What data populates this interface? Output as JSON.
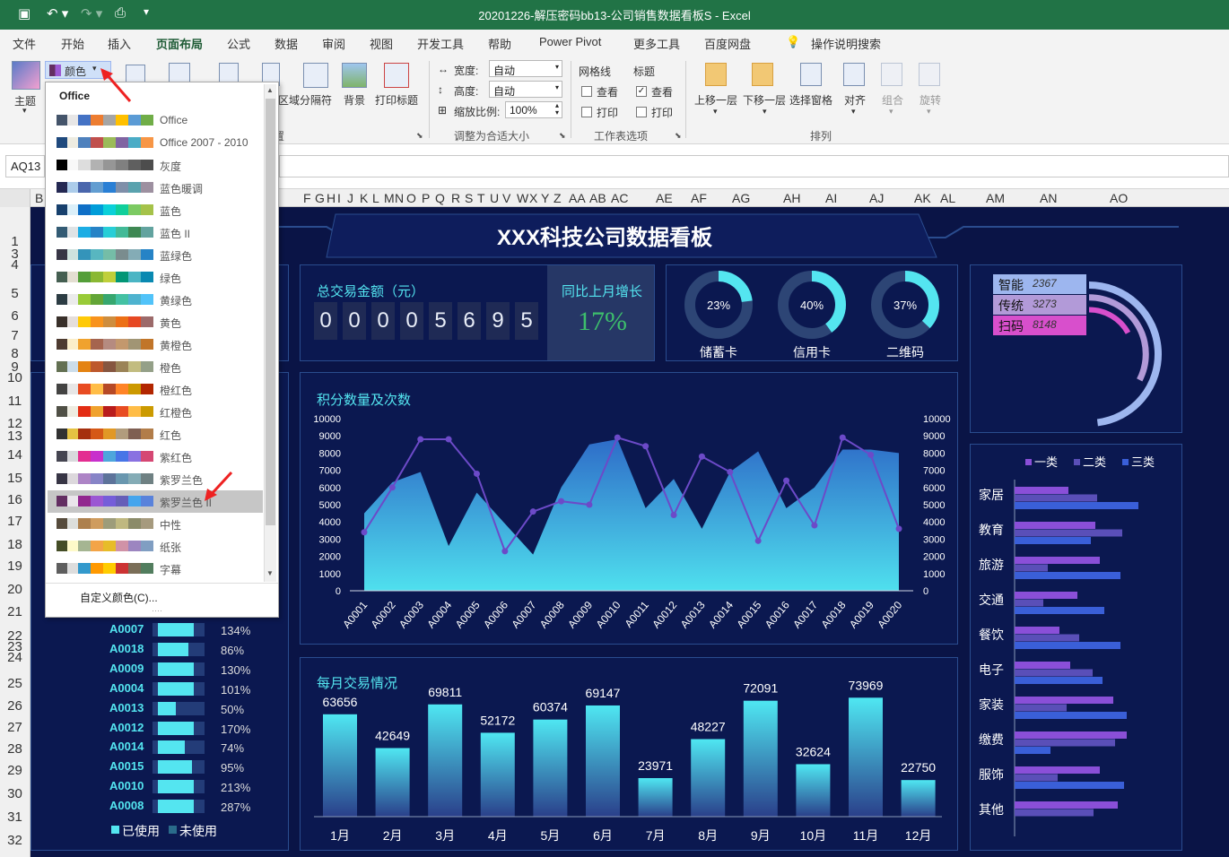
{
  "app": {
    "window_title": "20201226-解压密码bb13-公司销售数据看板S  -  Excel"
  },
  "tabs": [
    "文件",
    "开始",
    "插入",
    "页面布局",
    "公式",
    "数据",
    "审阅",
    "视图",
    "开发工具",
    "帮助",
    "Power Pivot",
    "更多工具",
    "百度网盘"
  ],
  "tab_search": "操作说明搜索",
  "ribbon": {
    "theme_label": "主题",
    "colors_label": "颜色",
    "btn_area": "区域",
    "btn_breaks": "分隔符",
    "btn_background": "背景",
    "btn_print_titles": "打印标题",
    "width_label": "宽度:",
    "width_value": "自动",
    "height_label": "高度:",
    "height_value": "自动",
    "scale_label": "缩放比例:",
    "scale_value": "100%",
    "group_fit": "调整为合适大小",
    "gridlines_label": "网格线",
    "headings_label": "标题",
    "view_label": "查看",
    "print_label": "打印",
    "group_sheet": "工作表选项",
    "bring_forward": "上移一层",
    "send_backward": "下移一层",
    "selection_pane": "选择窗格",
    "align": "对齐",
    "group": "组合",
    "rotate": "旋转",
    "group_arrange": "排列",
    "page_setup_group_suffix": "置"
  },
  "formula_bar": {
    "name_box": "AQ13"
  },
  "columns": [
    "B",
    "F",
    "G",
    "H",
    "I",
    "J",
    "K",
    "L",
    "M",
    "N",
    "O",
    "P",
    "Q",
    "R",
    "S",
    "T",
    "U",
    "V",
    "W",
    "X",
    "Y",
    "Z",
    "AA",
    "AB",
    "AC",
    "AE",
    "AF",
    "AG",
    "AH",
    "AI",
    "AJ",
    "AK",
    "AL",
    "AM",
    "AN",
    "AO"
  ],
  "rows": [
    "1",
    "3",
    "4",
    "5",
    "6",
    "7",
    "8",
    "9",
    "10",
    "11",
    "12",
    "13",
    "14",
    "15",
    "16",
    "17",
    "18",
    "19",
    "20",
    "21",
    "22",
    "23",
    "24",
    "25",
    "26",
    "27",
    "28",
    "29",
    "30",
    "31",
    "32"
  ],
  "dropdown": {
    "header": "Office",
    "items": [
      {
        "name": "Office",
        "colors": [
          "#44546a",
          "#e7e6e6",
          "#4472c4",
          "#ed7d31",
          "#a5a5a5",
          "#ffc000",
          "#5b9bd5",
          "#70ad47"
        ]
      },
      {
        "name": "Office 2007 - 2010",
        "colors": [
          "#1f497d",
          "#eeece1",
          "#4f81bd",
          "#c0504d",
          "#9bbb59",
          "#8064a2",
          "#4bacc6",
          "#f79646"
        ]
      },
      {
        "name": "灰度",
        "colors": [
          "#000000",
          "#f8f8f8",
          "#dddddd",
          "#b2b2b2",
          "#969696",
          "#808080",
          "#5f5f5f",
          "#4d4d4d"
        ]
      },
      {
        "name": "蓝色暖调",
        "colors": [
          "#242852",
          "#acccea",
          "#4a66ac",
          "#629dd1",
          "#297fd5",
          "#7f8fa9",
          "#5aa2ae",
          "#9d90a0"
        ]
      },
      {
        "name": "蓝色",
        "colors": [
          "#17406d",
          "#dbeff9",
          "#0f6fc6",
          "#009dd9",
          "#0bd0d9",
          "#10cf9b",
          "#7cca62",
          "#a5c249"
        ]
      },
      {
        "name": "蓝色 II",
        "colors": [
          "#335b74",
          "#dfe3e5",
          "#1cade4",
          "#2683c6",
          "#27ced7",
          "#42ba97",
          "#3e8853",
          "#62a39f"
        ]
      },
      {
        "name": "蓝绿色",
        "colors": [
          "#373545",
          "#cee2de",
          "#3494ba",
          "#58b6c0",
          "#75bda7",
          "#7a8c8e",
          "#84acb6",
          "#2683c6"
        ]
      },
      {
        "name": "绿色",
        "colors": [
          "#455f51",
          "#e3ded1",
          "#549e39",
          "#8ab833",
          "#c0cf3a",
          "#029676",
          "#4ab5c4",
          "#0989b1"
        ]
      },
      {
        "name": "黄绿色",
        "colors": [
          "#2c3c43",
          "#ebebeb",
          "#99cb38",
          "#63a537",
          "#37a76f",
          "#44c1a3",
          "#4eb3cf",
          "#51c3f9"
        ]
      },
      {
        "name": "黄色",
        "colors": [
          "#39302a",
          "#e5dedb",
          "#ffca08",
          "#f8931d",
          "#ce8d3e",
          "#ec7016",
          "#e64823",
          "#9c6a6a"
        ]
      },
      {
        "name": "黄橙色",
        "colors": [
          "#4e3b30",
          "#fbeec9",
          "#f0a22e",
          "#a5644e",
          "#b58b80",
          "#c3986d",
          "#a19574",
          "#c17529"
        ]
      },
      {
        "name": "橙色",
        "colors": [
          "#637052",
          "#ccddea",
          "#e48312",
          "#bd582c",
          "#865640",
          "#9b8357",
          "#c2bc80",
          "#94a088"
        ]
      },
      {
        "name": "橙红色",
        "colors": [
          "#434342",
          "#e7e6e6",
          "#e84c22",
          "#ffbd47",
          "#b64926",
          "#ff8427",
          "#cc9900",
          "#b22600"
        ]
      },
      {
        "name": "红橙色",
        "colors": [
          "#505046",
          "#eeece1",
          "#e32d14",
          "#f0a22e",
          "#b81c1c",
          "#e84c22",
          "#ffbd47",
          "#cb9a00"
        ]
      },
      {
        "name": "红色",
        "colors": [
          "#323232",
          "#e5c243",
          "#a5300f",
          "#d55816",
          "#e19825",
          "#b19c7d",
          "#7f5f52",
          "#b27d49"
        ]
      },
      {
        "name": "紫红色",
        "colors": [
          "#454551",
          "#d8d9dc",
          "#e32d91",
          "#c830cc",
          "#4ea6dc",
          "#4775e7",
          "#8971e1",
          "#d54773"
        ]
      },
      {
        "name": "紫罗兰色",
        "colors": [
          "#373545",
          "#dcd8dc",
          "#ad84c6",
          "#8784c7",
          "#5d739a",
          "#6997af",
          "#84acb6",
          "#6f8183"
        ]
      },
      {
        "name": "紫罗兰色 II",
        "colors": [
          "#632e62",
          "#eae5eb",
          "#92278f",
          "#9b57d3",
          "#755dd9",
          "#665eb8",
          "#45a5ed",
          "#5982db"
        ]
      },
      {
        "name": "中性",
        "colors": [
          "#564b3c",
          "#dcdedb",
          "#ad804e",
          "#cf9c5e",
          "#9d9c7a",
          "#bfb880",
          "#8b8b69",
          "#a69a7e"
        ]
      },
      {
        "name": "纸张",
        "colors": [
          "#444d26",
          "#fefac9",
          "#a5b592",
          "#f3a447",
          "#e7bc29",
          "#d092a7",
          "#9c85c0",
          "#809ec2"
        ]
      },
      {
        "name": "字幕",
        "colors": [
          "#5e5e5e",
          "#dddddd",
          "#3399cc",
          "#ff9900",
          "#ffcc00",
          "#cc3333",
          "#7a6e58",
          "#527d5e"
        ]
      }
    ],
    "footer": "自定义颜色(C)...",
    "selected_index": 17
  },
  "dashboard": {
    "title": "XXX科技公司数据看板",
    "total_label": "总交易金额（元）",
    "digits": [
      "0",
      "0",
      "0",
      "0",
      "5",
      "6",
      "9",
      "5"
    ],
    "growth_label": "同比上月增长",
    "growth_value": "17%",
    "rings": [
      {
        "label": "储蓄卡",
        "pct": "23%",
        "value": 0.23
      },
      {
        "label": "信用卡",
        "pct": "40%",
        "value": 0.4
      },
      {
        "label": "二维码",
        "pct": "37%",
        "value": 0.37
      }
    ],
    "legend_box": [
      {
        "name": "智能",
        "value": "2367",
        "color": "#9db6ef"
      },
      {
        "name": "传统",
        "value": "3273",
        "color": "#b29ad8"
      },
      {
        "name": "扫码",
        "value": "8148",
        "color": "#d84fcc"
      }
    ],
    "points_title": "积分数量及次数",
    "monthly_title": "每月交易情况",
    "hbar_legend": [
      "一类",
      "二类",
      "三类"
    ],
    "hbar_categories": [
      "家居",
      "教育",
      "旅游",
      "交通",
      "餐饮",
      "电子",
      "家装",
      "缴费",
      "服饰",
      "其他"
    ],
    "progress_legend": [
      "已使用",
      "未使用"
    ],
    "progress_rows": [
      {
        "id": "A0007",
        "pct": "134%",
        "value": 1.34
      },
      {
        "id": "A0018",
        "pct": "86%",
        "value": 0.86
      },
      {
        "id": "A0009",
        "pct": "130%",
        "value": 1.3
      },
      {
        "id": "A0004",
        "pct": "101%",
        "value": 1.01
      },
      {
        "id": "A0013",
        "pct": "50%",
        "value": 0.5
      },
      {
        "id": "A0012",
        "pct": "170%",
        "value": 1.7
      },
      {
        "id": "A0014",
        "pct": "74%",
        "value": 0.74
      },
      {
        "id": "A0015",
        "pct": "95%",
        "value": 0.95
      },
      {
        "id": "A0010",
        "pct": "213%",
        "value": 2.13
      },
      {
        "id": "A0008",
        "pct": "287%",
        "value": 2.87
      }
    ]
  },
  "chart_data": [
    {
      "type": "line",
      "title": "积分数量及次数",
      "x": [
        "A0001",
        "A0002",
        "A0003",
        "A0004",
        "A0005",
        "A0006",
        "A0007",
        "A0008",
        "A0009",
        "A0010",
        "A0011",
        "A0012",
        "A0013",
        "A0014",
        "A0015",
        "A0016",
        "A0017",
        "A0018",
        "A0019",
        "A0020"
      ],
      "ylim": [
        0,
        10000
      ],
      "yticks": [
        "10000",
        "9000",
        "8000",
        "7000",
        "6000",
        "5000",
        "4000",
        "3000",
        "2000",
        "1000",
        "0"
      ],
      "series": [
        {
          "kind": "area",
          "values": [
            4500,
            6300,
            6900,
            2600,
            5700,
            3900,
            2100,
            6000,
            8500,
            8800,
            4800,
            6500,
            3600,
            6900,
            8100,
            4800,
            6000,
            8200,
            8200,
            8000
          ]
        },
        {
          "kind": "line",
          "values": [
            3400,
            6000,
            8800,
            8800,
            6800,
            2300,
            4600,
            5200,
            5000,
            8900,
            8400,
            4400,
            7800,
            6900,
            2900,
            6400,
            3800,
            8900,
            7900,
            3600
          ]
        }
      ]
    },
    {
      "type": "bar",
      "title": "每月交易情况",
      "categories": [
        "1月",
        "2月",
        "3月",
        "4月",
        "5月",
        "6月",
        "7月",
        "8月",
        "9月",
        "10月",
        "11月",
        "12月"
      ],
      "values": [
        63656,
        42649,
        69811,
        52172,
        60374,
        69147,
        23971,
        48227,
        72091,
        32624,
        73969,
        22750
      ],
      "ylim": [
        0,
        80000
      ]
    },
    {
      "type": "bar",
      "orientation": "horizontal",
      "categories": [
        "家居",
        "教育",
        "旅游",
        "交通",
        "餐饮",
        "电子",
        "家装",
        "缴费",
        "服饰",
        "其他"
      ],
      "series": [
        {
          "name": "一类",
          "values": [
            60,
            90,
            95,
            70,
            50,
            62,
            110,
            125,
            95,
            115
          ]
        },
        {
          "name": "二类",
          "values": [
            92,
            120,
            37,
            32,
            72,
            87,
            58,
            112,
            48,
            88
          ]
        },
        {
          "name": "三类",
          "values": [
            138,
            85,
            118,
            100,
            118,
            98,
            125,
            40,
            122
          ]
        }
      ]
    }
  ],
  "colors": {
    "excel_green": "#217346",
    "dash_bg": "#0a1446",
    "cyan": "#54e5f0",
    "purple": "#7b4ed8",
    "bar_blue": "#3a5fd8"
  }
}
